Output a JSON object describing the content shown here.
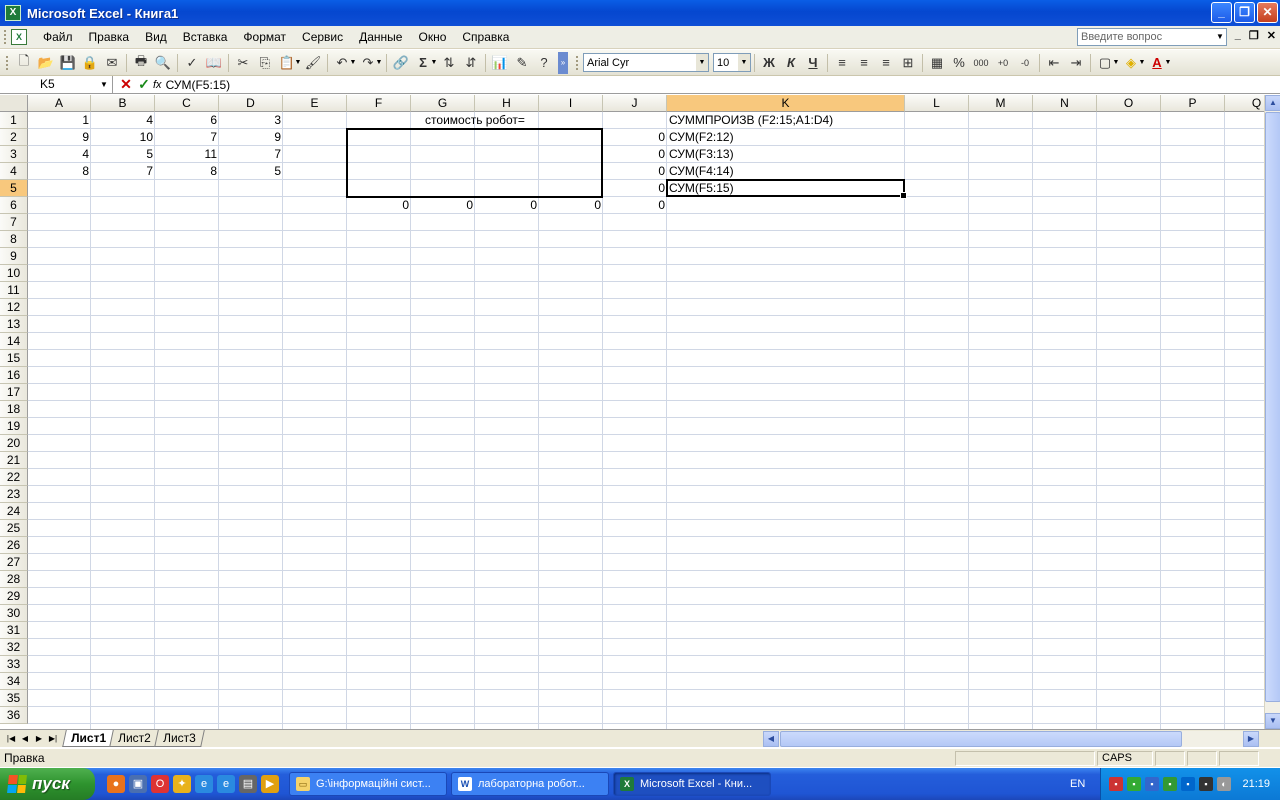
{
  "window": {
    "title": "Microsoft Excel - Книга1",
    "app_icon": "excel-icon"
  },
  "menu": {
    "items": [
      "Файл",
      "Правка",
      "Вид",
      "Вставка",
      "Формат",
      "Сервис",
      "Данные",
      "Окно",
      "Справка"
    ],
    "question_placeholder": "Введите вопрос"
  },
  "toolbar": {
    "font_name": "Arial Cyr",
    "font_size": "10",
    "bold_label": "Ж",
    "italic_label": "К",
    "underline_label": "Ч",
    "sum_label": "Σ",
    "percent_label": "%",
    "thousands_label": "000"
  },
  "formula_bar": {
    "name_box": "K5",
    "fx_label": "fx",
    "formula": "СУМ(F5:15)"
  },
  "sheet": {
    "columns": [
      "A",
      "B",
      "C",
      "D",
      "E",
      "F",
      "G",
      "H",
      "I",
      "J",
      "K",
      "L",
      "M",
      "N",
      "O",
      "P",
      "Q"
    ],
    "selected_column": "K",
    "selected_row": 5,
    "rows": [
      "1",
      "2",
      "3",
      "4",
      "5",
      "6",
      "7",
      "8",
      "9",
      "10",
      "11",
      "12",
      "13",
      "14",
      "15",
      "16",
      "17",
      "18",
      "19",
      "20",
      "21",
      "22",
      "23",
      "24",
      "25",
      "26",
      "27",
      "28",
      "29",
      "30",
      "31",
      "32",
      "33",
      "34",
      "35",
      "36"
    ],
    "cells": {
      "A1": "1",
      "B1": "4",
      "C1": "6",
      "D1": "3",
      "A2": "9",
      "B2": "10",
      "C2": "7",
      "D2": "9",
      "A3": "4",
      "B3": "5",
      "C3": "11",
      "D3": "7",
      "A4": "8",
      "B4": "7",
      "C4": "8",
      "D4": "5",
      "G1": "стоимость робот=",
      "J2": "0",
      "J3": "0",
      "J4": "0",
      "J5": "0",
      "J6": "0",
      "F6": "0",
      "G6": "0",
      "H6": "0",
      "I6": "0",
      "K1": "СУММПРОИЗВ (F2:15;A1:D4)",
      "K2": "СУМ(F2:12)",
      "K3": "СУМ(F3:13)",
      "K4": "СУМ(F4:14)",
      "K5": "СУМ(F5:15)"
    }
  },
  "sheet_tabs": [
    "Лист1",
    "Лист2",
    "Лист3"
  ],
  "status": {
    "text": "Правка",
    "caps": "CAPS"
  },
  "taskbar": {
    "start_label": "пуск",
    "tasks": [
      {
        "label": "G:\\інформаційні сист...",
        "icon": "folder-icon"
      },
      {
        "label": "лабораторна робот...",
        "icon": "word-icon"
      },
      {
        "label": "Microsoft Excel - Кни...",
        "icon": "excel-icon"
      }
    ],
    "language": "EN",
    "clock": "21:19"
  },
  "colors": {
    "title_bar": "#0a5ee6",
    "selected_header": "#f8c87d",
    "taskbar": "#245edb",
    "start_button": "#2e932e"
  }
}
